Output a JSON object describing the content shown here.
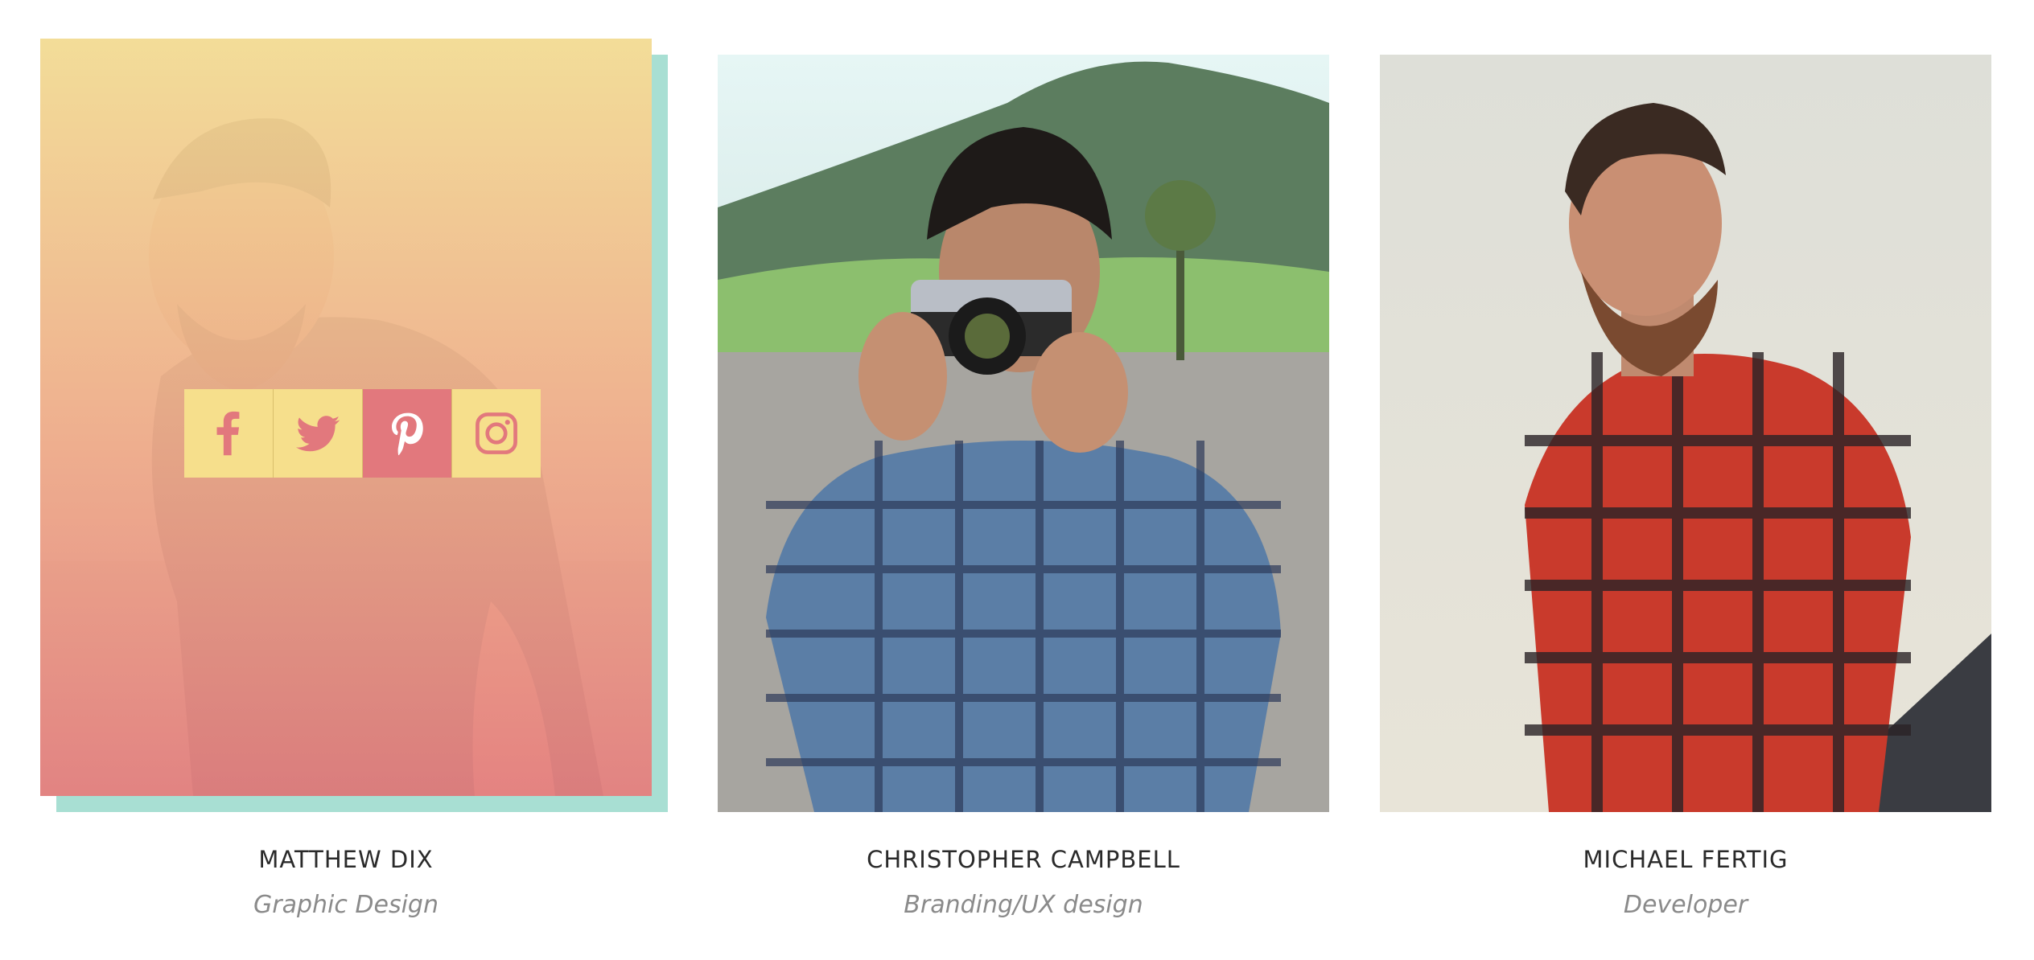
{
  "members": [
    {
      "name": "MATTHEW DIX",
      "role": "Graphic Design",
      "social": [
        {
          "network": "facebook",
          "icon": "facebook-icon"
        },
        {
          "network": "twitter",
          "icon": "twitter-icon"
        },
        {
          "network": "pinterest",
          "icon": "pinterest-icon"
        },
        {
          "network": "instagram",
          "icon": "instagram-icon"
        }
      ]
    },
    {
      "name": "CHRISTOPHER CAMPBELL",
      "role": "Branding/UX design"
    },
    {
      "name": "MICHAEL FERTIG",
      "role": "Developer"
    }
  ],
  "colors": {
    "overlay_top": "#f6df96",
    "overlay_bottom": "#e58080",
    "shadow": "#a8dfd3",
    "social_bg": "#f6df8c",
    "social_active": "#e2787d",
    "name_text": "#2a2a2a",
    "role_text": "#8a8a8a"
  }
}
